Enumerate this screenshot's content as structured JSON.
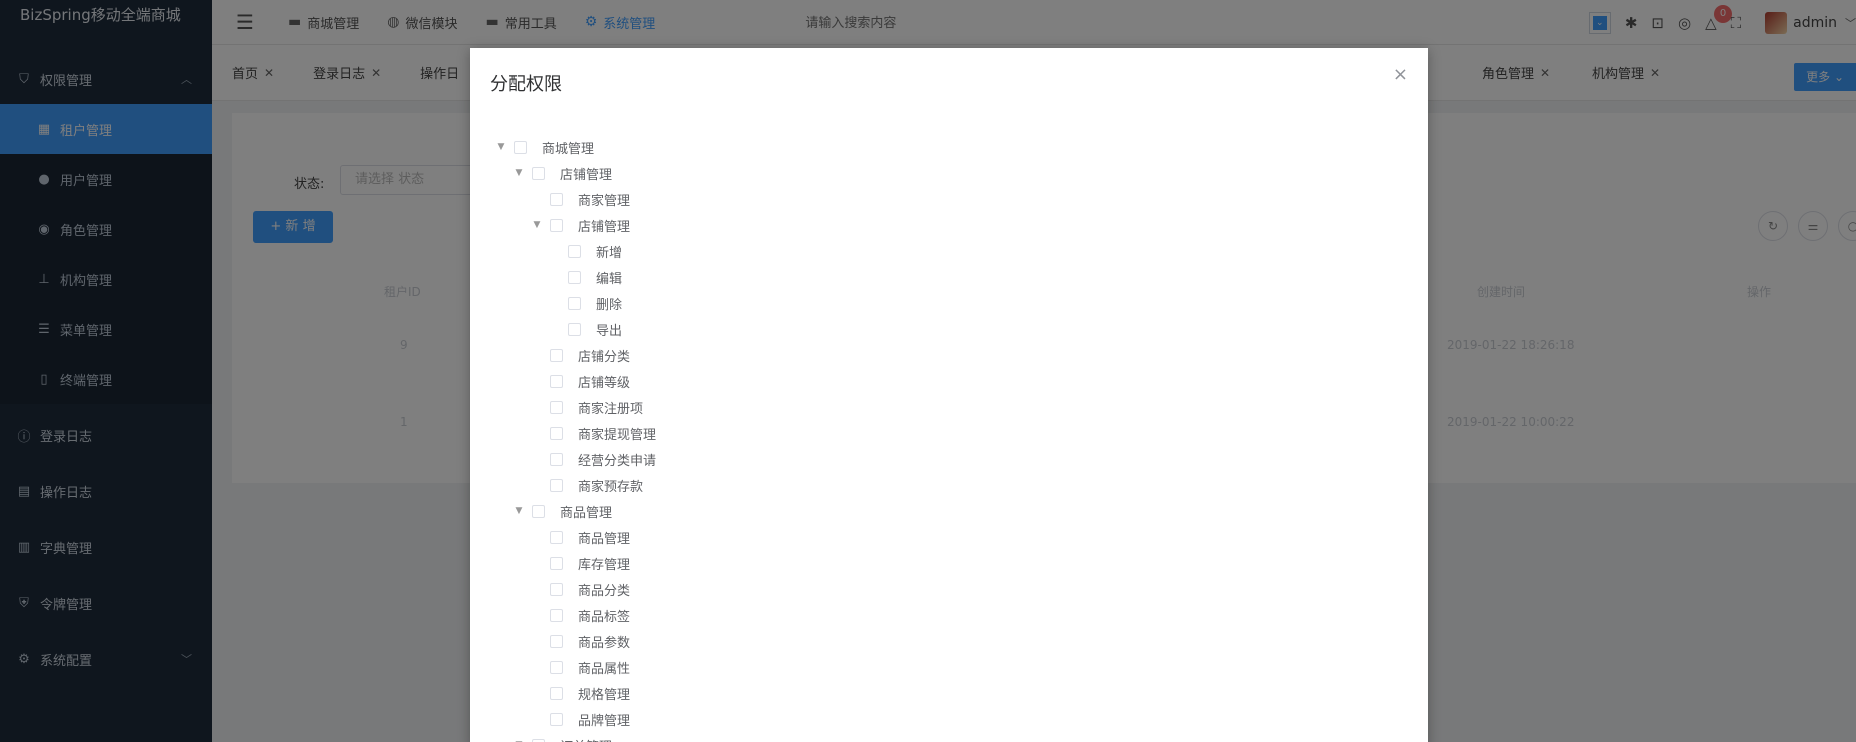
{
  "app": {
    "brand": "BizSpring移动全端商城"
  },
  "sidebar": {
    "groups": [
      {
        "label": "权限管理",
        "icon": "shield-icon",
        "expanded": true
      },
      {
        "label": "登录日志",
        "icon": "info-icon"
      },
      {
        "label": "操作日志",
        "icon": "clipboard-icon"
      },
      {
        "label": "字典管理",
        "icon": "book-icon"
      },
      {
        "label": "令牌管理",
        "icon": "shield-check-icon"
      },
      {
        "label": "系统配置",
        "icon": "gear-icon",
        "expanded": false
      }
    ],
    "sub_items": [
      {
        "label": "租户管理",
        "icon": "grid-icon",
        "active": true
      },
      {
        "label": "用户管理",
        "icon": "user-icon"
      },
      {
        "label": "角色管理",
        "icon": "user-role-icon"
      },
      {
        "label": "机构管理",
        "icon": "org-tree-icon"
      },
      {
        "label": "菜单管理",
        "icon": "menu-list-icon"
      },
      {
        "label": "终端管理",
        "icon": "mobile-icon"
      }
    ]
  },
  "topbar": {
    "nav": [
      {
        "label": "商城管理",
        "icon": "monitor-icon"
      },
      {
        "label": "微信模块",
        "icon": "wechat-icon"
      },
      {
        "label": "常用工具",
        "icon": "monitor-icon"
      },
      {
        "label": "系统管理",
        "icon": "gear-icon",
        "active": true
      }
    ],
    "search_placeholder": "请输入搜索内容",
    "notification_count": "0",
    "username": "admin"
  },
  "tabs": [
    {
      "label": "首页"
    },
    {
      "label": "登录日志"
    },
    {
      "label": "操作日"
    },
    {
      "label": "角色管理"
    },
    {
      "label": "机构管理"
    }
  ],
  "more_label": "更多",
  "content": {
    "status_label": "状态:",
    "status_placeholder": "请选择 状态",
    "add_label": "+ 新 增",
    "col_id": "租户ID",
    "col_time": "创建时间",
    "col_action": "操作",
    "row_ids": [
      "9",
      "1"
    ],
    "row_times": [
      "2019-01-22 18:26:18",
      "2019-01-22 10:00:22"
    ]
  },
  "dialog": {
    "title": "分配权限",
    "close": "×",
    "tree": [
      {
        "label": "商城管理",
        "level": 0,
        "expand": true
      },
      {
        "label": "店铺管理",
        "level": 1,
        "expand": true
      },
      {
        "label": "商家管理",
        "level": 2
      },
      {
        "label": "店铺管理",
        "level": 2,
        "expand": true
      },
      {
        "label": "新增",
        "level": 3
      },
      {
        "label": "编辑",
        "level": 3
      },
      {
        "label": "删除",
        "level": 3
      },
      {
        "label": "导出",
        "level": 3
      },
      {
        "label": "店铺分类",
        "level": 2
      },
      {
        "label": "店铺等级",
        "level": 2
      },
      {
        "label": "商家注册项",
        "level": 2
      },
      {
        "label": "商家提现管理",
        "level": 2
      },
      {
        "label": "经营分类申请",
        "level": 2
      },
      {
        "label": "商家预存款",
        "level": 2
      },
      {
        "label": "商品管理",
        "level": 1,
        "expand": true
      },
      {
        "label": "商品管理",
        "level": 2
      },
      {
        "label": "库存管理",
        "level": 2
      },
      {
        "label": "商品分类",
        "level": 2
      },
      {
        "label": "商品标签",
        "level": 2
      },
      {
        "label": "商品参数",
        "level": 2
      },
      {
        "label": "商品属性",
        "level": 2
      },
      {
        "label": "规格管理",
        "level": 2
      },
      {
        "label": "品牌管理",
        "level": 2
      },
      {
        "label": "订单管理",
        "level": 1,
        "expand": true
      }
    ]
  }
}
